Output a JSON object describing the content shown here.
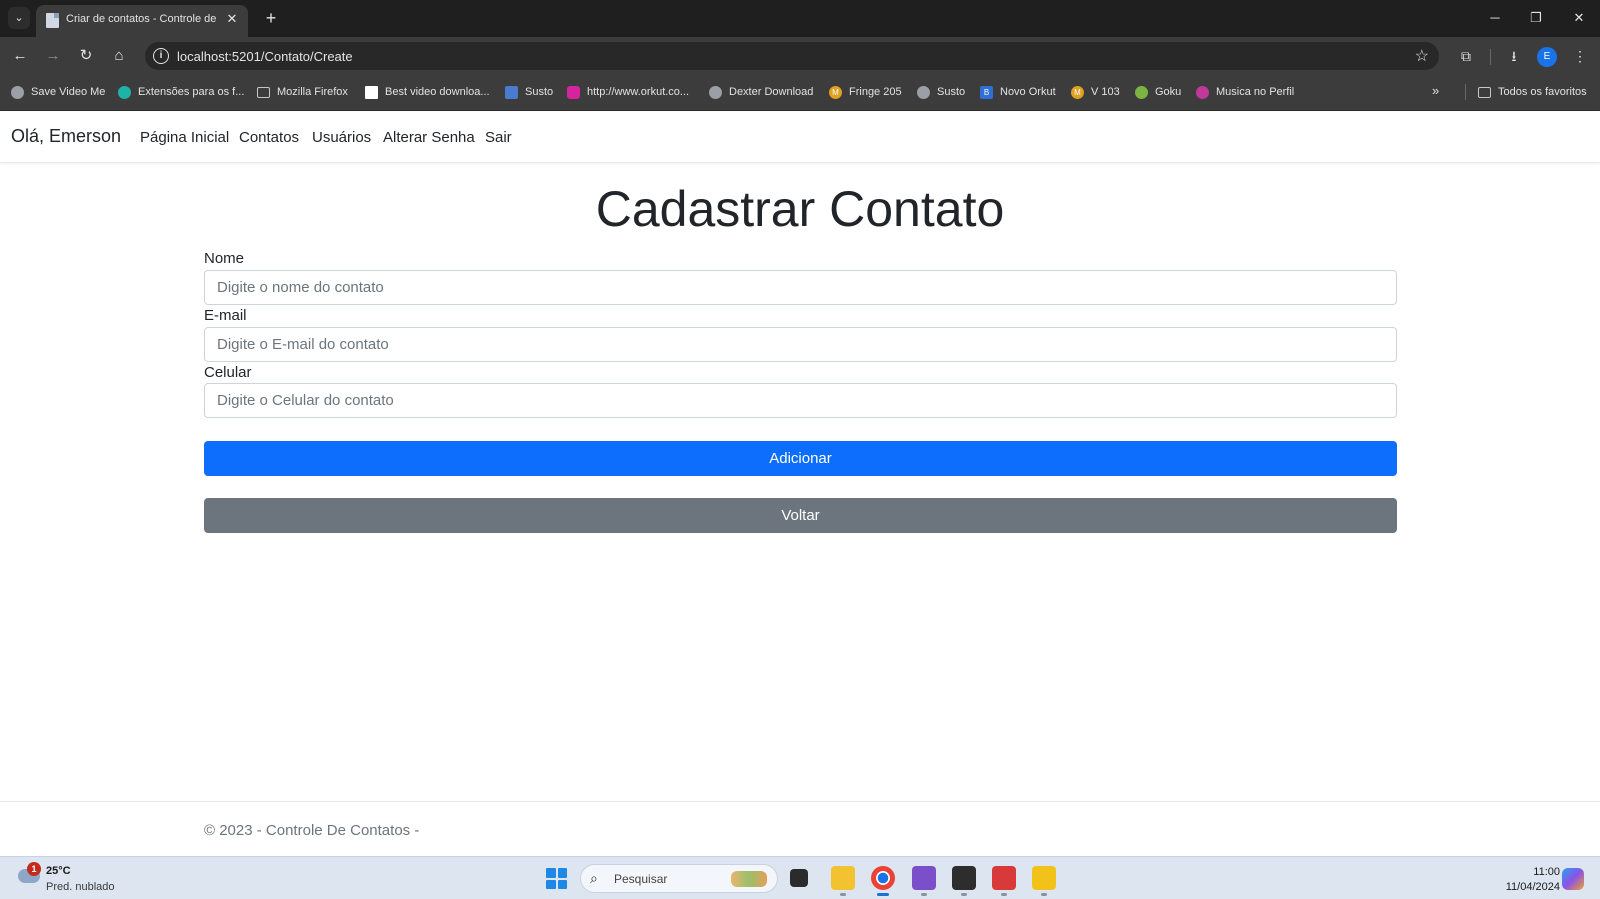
{
  "browser": {
    "tab_title": "Criar de contatos - Controle de",
    "url": "localhost:5201/Contato/Create",
    "profile_initial": "E",
    "bookmarks": [
      {
        "label": "Save Video Me",
        "icon": "globe-icon",
        "color": "#9aa0a6"
      },
      {
        "label": "Extensões para os f...",
        "icon": "puzzle-icon",
        "color": "#1fb3a8"
      },
      {
        "label": "Mozilla Firefox",
        "icon": "folder-icon",
        "color": ""
      },
      {
        "label": "Best video downloa...",
        "icon": "page-icon",
        "color": "#ffffff"
      },
      {
        "label": "Susto",
        "icon": "camera-icon",
        "color": "#4a7bd0"
      },
      {
        "label": "http://www.orkut.co...",
        "icon": "instagram-icon",
        "color": "#d6249f"
      },
      {
        "label": "Dexter Download",
        "icon": "globe-icon",
        "color": "#9aa0a6"
      },
      {
        "label": "Fringe 205",
        "icon": "m-badge-icon",
        "color": "#e0a020"
      },
      {
        "label": "Susto",
        "icon": "globe-icon",
        "color": "#9aa0a6"
      },
      {
        "label": "Novo Orkut",
        "icon": "b-icon",
        "color": "#2f6fd6"
      },
      {
        "label": "V 103",
        "icon": "m-badge-icon",
        "color": "#e0a020"
      },
      {
        "label": "Goku",
        "icon": "star-icon",
        "color": "#7cb342"
      },
      {
        "label": "Musica no Perfil",
        "icon": "swirl-icon",
        "color": "#c0399a"
      }
    ],
    "all_bookmarks_label": "Todos os favoritos"
  },
  "nav": {
    "brand": "Olá, Emerson",
    "links": [
      "Página Inicial",
      "Contatos",
      "Usuários",
      "Alterar Senha",
      "Sair"
    ]
  },
  "page": {
    "title": "Cadastrar Contato",
    "fields": [
      {
        "label": "Nome",
        "placeholder": "Digite o nome do contato",
        "value": ""
      },
      {
        "label": "E-mail",
        "placeholder": "Digite o E-mail do contato",
        "value": ""
      },
      {
        "label": "Celular",
        "placeholder": "Digite o Celular do contato",
        "value": ""
      }
    ],
    "submit_label": "Adicionar",
    "back_label": "Voltar",
    "footer": "© 2023 - Controle De Contatos -"
  },
  "taskbar": {
    "weather_temp": "25°C",
    "weather_desc": "Pred. nublado",
    "weather_badge": "1",
    "search_placeholder": "Pesquisar",
    "time": "11:00",
    "date": "11/04/2024"
  },
  "colors": {
    "primary": "#0d6efd",
    "secondary": "#6c757d",
    "chrome_dark": "#1f1f1f",
    "chrome_toolbar": "#3c3c3c"
  }
}
